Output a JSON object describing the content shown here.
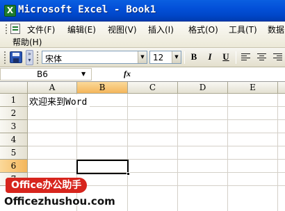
{
  "window": {
    "title": "Microsoft Excel - Book1",
    "app_icon_letter": "X"
  },
  "menu": {
    "row1": [
      "文件(F)",
      "编辑(E)",
      "视图(V)",
      "插入(I)",
      "格式(O)",
      "工具(T)",
      "数据"
    ],
    "row2": [
      "帮助(H)"
    ]
  },
  "toolbar": {
    "font_name": "宋体",
    "font_size": "12",
    "bold_label": "B",
    "italic_label": "I",
    "underline_label": "U",
    "more_glyph": "»"
  },
  "formula_bar": {
    "name_box": "B6",
    "fx_label": "fx",
    "formula_value": ""
  },
  "sheet": {
    "columns": [
      "A",
      "B",
      "C",
      "D",
      "E"
    ],
    "rows": [
      "1",
      "2",
      "3",
      "4",
      "5",
      "6",
      "7"
    ],
    "selected_column": "B",
    "selected_row": "6",
    "active_cell": "B6",
    "cells": {
      "A1": "欢迎来到Word"
    }
  },
  "watermark": {
    "badge": "Office办公助手",
    "url": "Officezhushou.com",
    "badge_color": "#d7251d"
  },
  "colors": {
    "title_bar": "#0350d8",
    "selection_header": "#f4b65b"
  }
}
